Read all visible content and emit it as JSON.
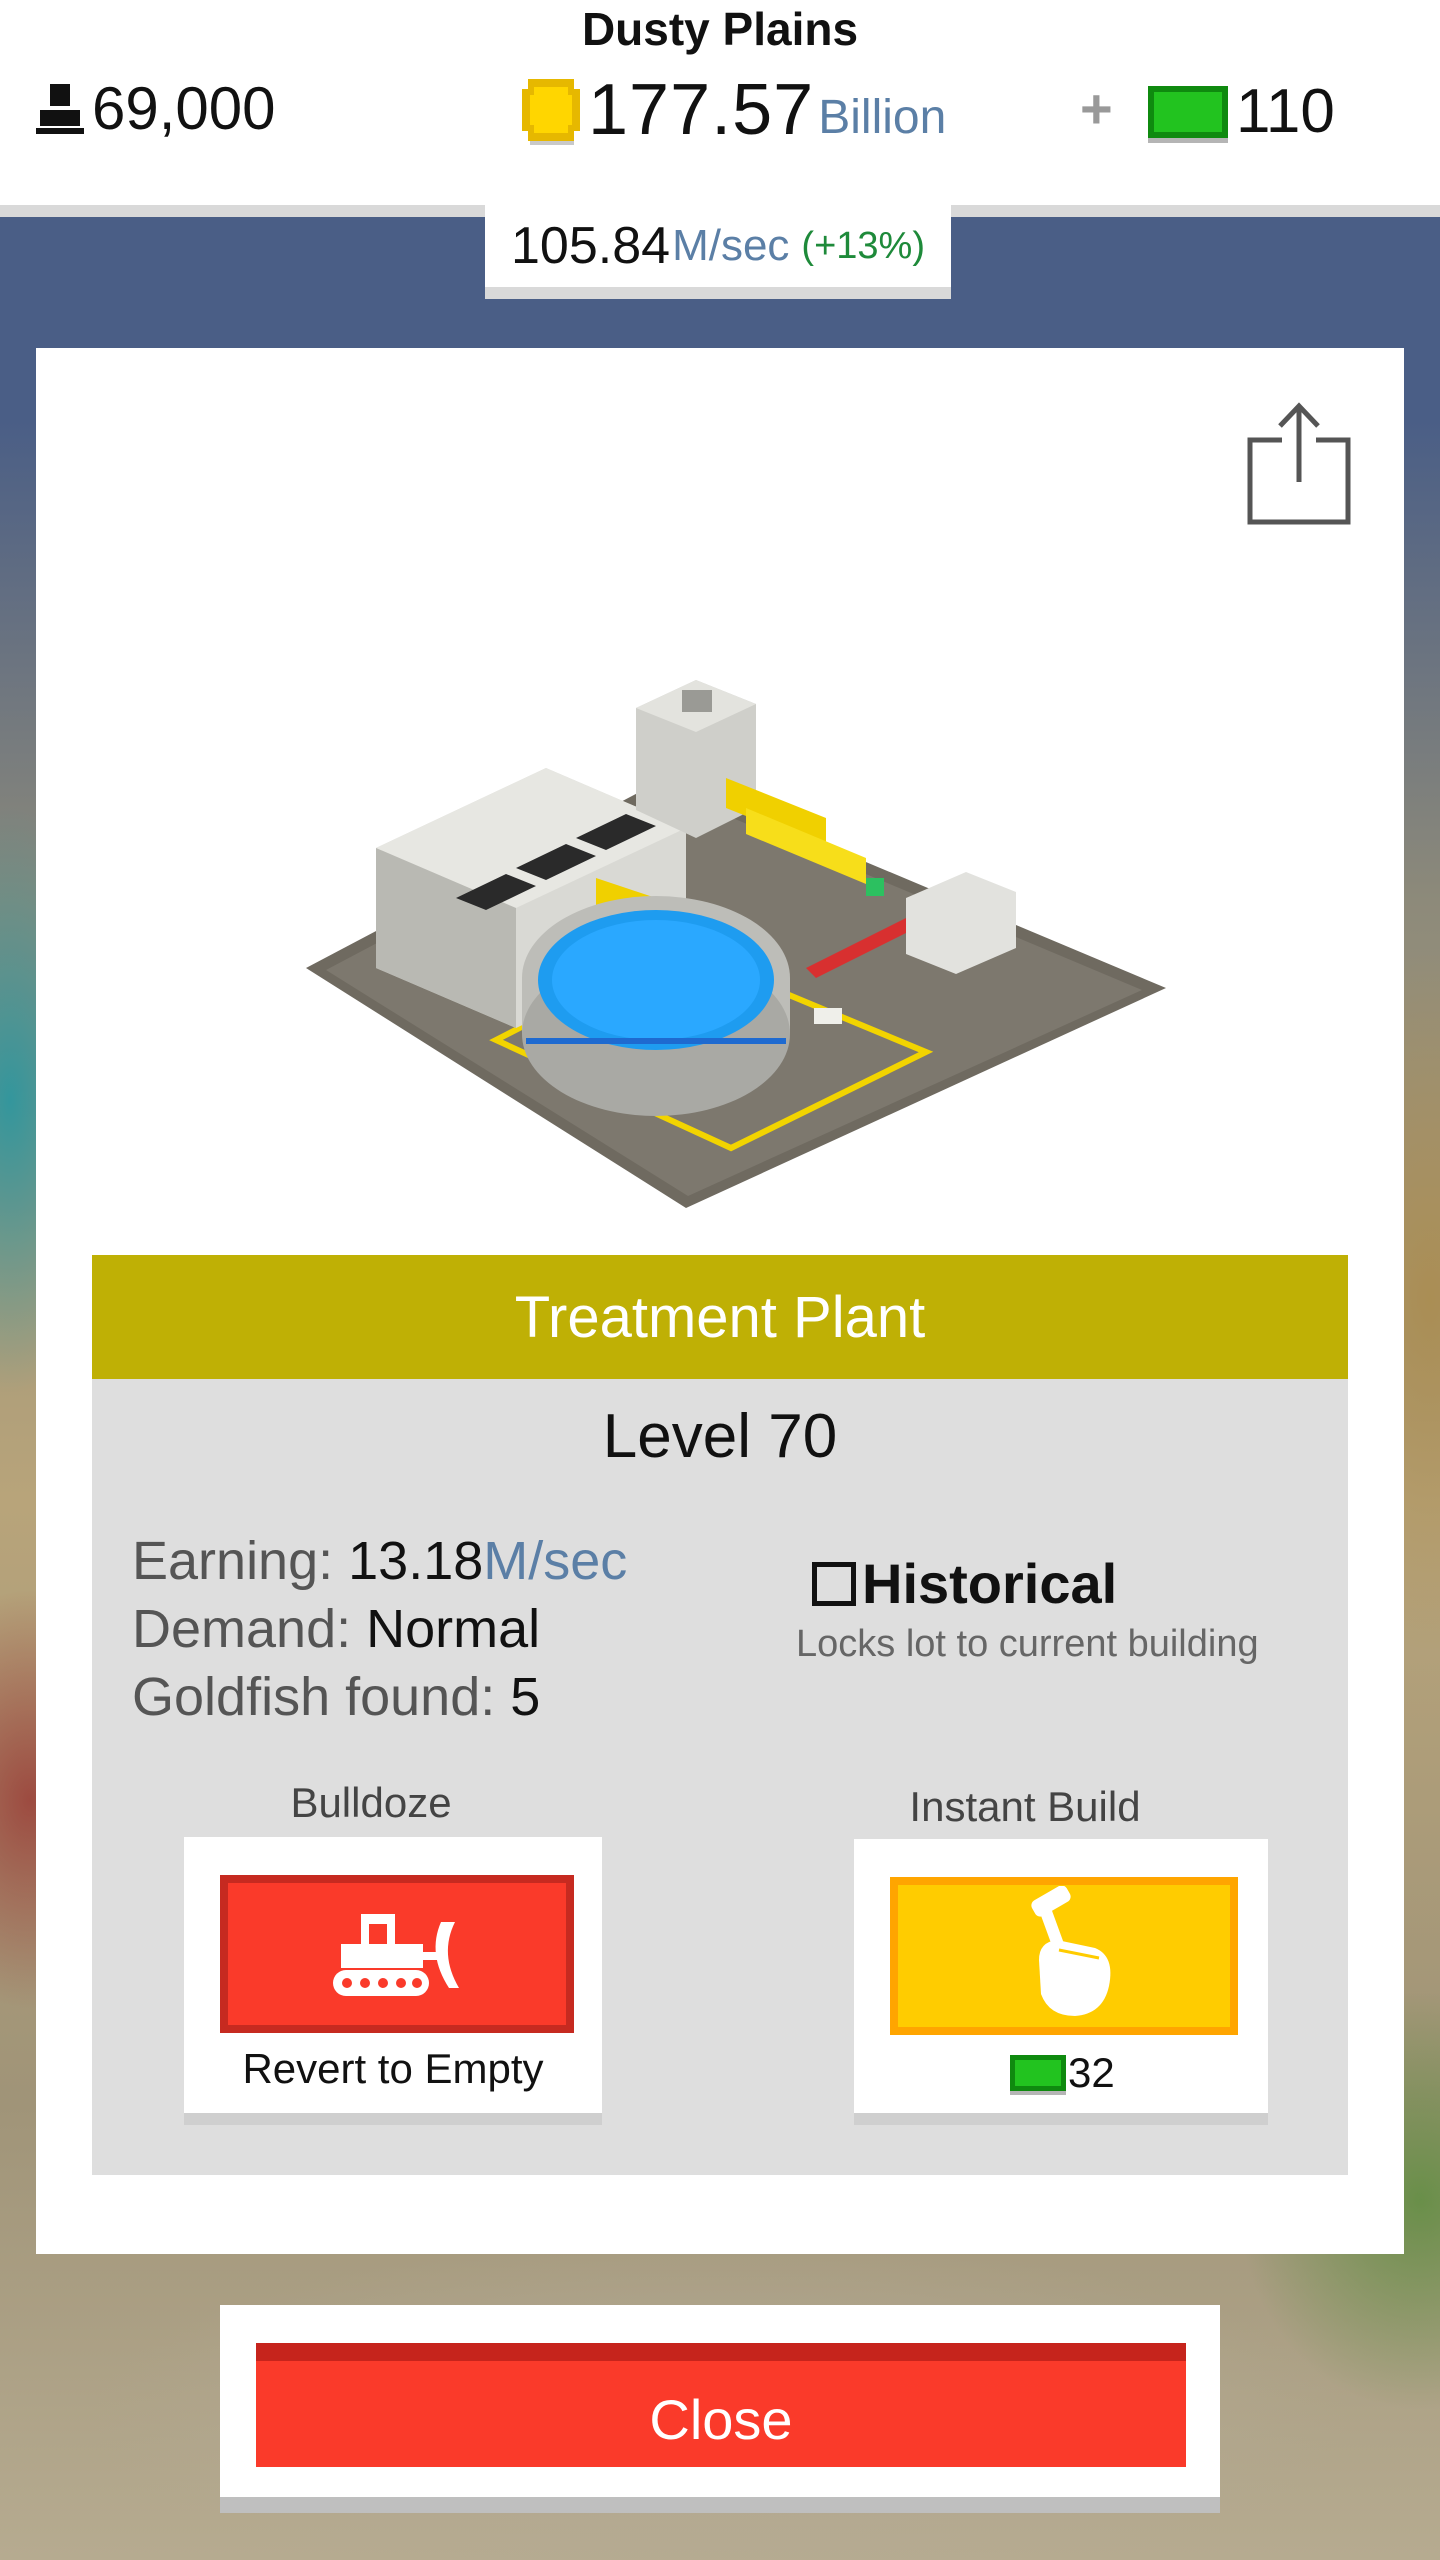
{
  "header": {
    "city_name": "Dusty Plains",
    "population": "69,000",
    "coins_amount": "177.57",
    "coins_unit": "Billion",
    "plus_label": "+",
    "cash_amount": "110",
    "rate_value": "105.84",
    "rate_unit": "M/sec",
    "rate_change": "(+13%)"
  },
  "building": {
    "name": "Treatment Plant",
    "level": "Level 70",
    "earning_label": "Earning: ",
    "earning_value": "13.18",
    "earning_unit": "M/sec",
    "demand_label": "Demand: ",
    "demand_value": "Normal",
    "goldfish_label": "Goldfish found: ",
    "goldfish_value": "5",
    "historical_label": "Historical",
    "historical_desc": "Locks lot to current building",
    "historical_checked": false
  },
  "actions": {
    "bulldoze_title": "Bulldoze",
    "bulldoze_caption": "Revert to Empty",
    "instant_build_title": "Instant Build",
    "instant_build_cost": "32",
    "close_label": "Close"
  },
  "icons": {
    "population": "person-icon",
    "coins": "coin-icon",
    "cash": "cash-icon",
    "share": "share-icon",
    "bulldoze": "bulldozer-icon",
    "instant_build": "hammer-hand-icon"
  },
  "colors": {
    "title_bar": "#bfb005",
    "bulldoze_button": "#fa3a2a",
    "instant_build_button": "#ffcc00",
    "close_button": "#fa3a2a",
    "cash_green": "#22c31f",
    "unit_blue": "#5b7fa6",
    "rate_change_green": "#1e8a3a"
  }
}
